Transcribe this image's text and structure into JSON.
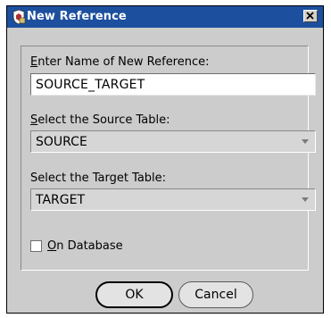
{
  "dialog": {
    "title": "New Reference",
    "close_icon": "close-icon",
    "app_icon": "app-icon"
  },
  "form": {
    "name_label": "Enter Name of New Reference:",
    "name_value": "SOURCE_TARGET",
    "source_label": "Select the Source Table:",
    "source_value": "SOURCE",
    "target_label": "Select the Target Table:",
    "target_value": "TARGET",
    "on_database_label": "On Database",
    "on_database_checked": false
  },
  "buttons": {
    "ok_label": "OK",
    "cancel_label": "Cancel"
  },
  "colors": {
    "titlebar": "#1c4f9e",
    "dialog_background": "#cccccc"
  }
}
